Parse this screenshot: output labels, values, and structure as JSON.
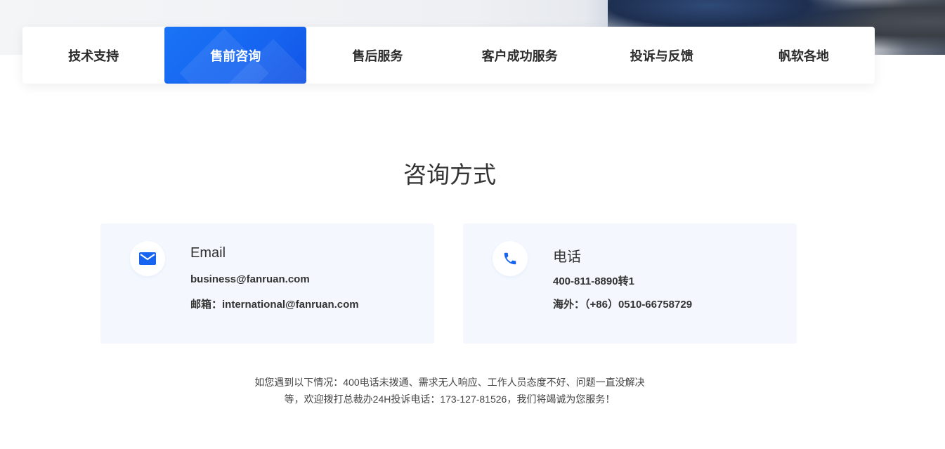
{
  "tabs": [
    {
      "label": "技术支持",
      "active": false
    },
    {
      "label": "售前咨询",
      "active": true
    },
    {
      "label": "售后服务",
      "active": false
    },
    {
      "label": "客户成功服务",
      "active": false
    },
    {
      "label": "投诉与反馈",
      "active": false
    },
    {
      "label": "帆软各地",
      "active": false
    }
  ],
  "section": {
    "title": "咨询方式"
  },
  "email_card": {
    "icon": "mail-icon",
    "title": "Email",
    "line1": "business@fanruan.com",
    "line2": "邮箱：international@fanruan.com"
  },
  "phone_card": {
    "icon": "phone-icon",
    "title": "电话",
    "line1": "400-811-8890转1",
    "line2": "海外：（+86）0510-66758729"
  },
  "notice": {
    "line1": "如您遇到以下情况：400电话未拨通、需求无人响应、工作人员态度不好、问题一直没解决",
    "line2": "等，欢迎拨打总裁办24H投诉电话：173-127-81526，我们将竭诚为您服务！"
  },
  "colors": {
    "accent": "#1664f0",
    "card_bg": "#f4f8fe"
  }
}
